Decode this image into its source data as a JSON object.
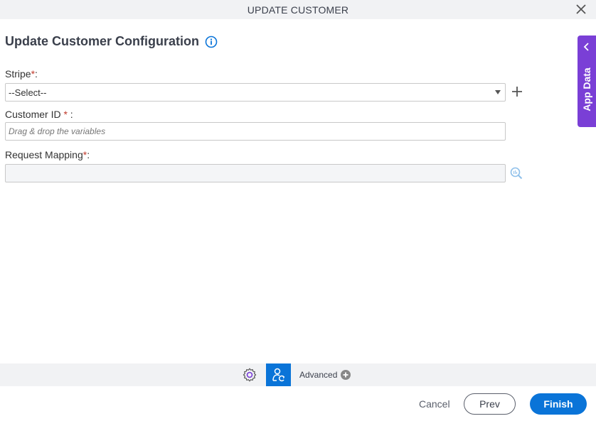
{
  "dialog": {
    "title": "UPDATE CUSTOMER",
    "close_icon": "close-icon"
  },
  "form": {
    "heading": "Update Customer Configuration",
    "info_icon": "info-icon",
    "stripe": {
      "label": "Stripe",
      "required_mark": "*",
      "suffix": ":",
      "value": "--Select--",
      "add_icon": "plus-icon"
    },
    "customer_id": {
      "label": "Customer ID ",
      "required_mark": "*",
      "suffix": " :",
      "placeholder": "Drag & drop the variables"
    },
    "request_mapping": {
      "label": "Request Mapping",
      "required_mark": "*",
      "suffix": ":",
      "value": "",
      "mapping_icon": "mapping-search-icon"
    }
  },
  "side_panel": {
    "label": "App Data",
    "icon": "chevron-left-icon",
    "color": "#7a3fd6"
  },
  "toolbar": {
    "settings_icon": "gear-icon",
    "user_icon": "user-refresh-icon",
    "advanced_label": "Advanced",
    "advanced_icon": "plus-circle-icon"
  },
  "footer": {
    "cancel_label": "Cancel",
    "prev_label": "Prev",
    "finish_label": "Finish",
    "accent": "#0a74d8"
  }
}
